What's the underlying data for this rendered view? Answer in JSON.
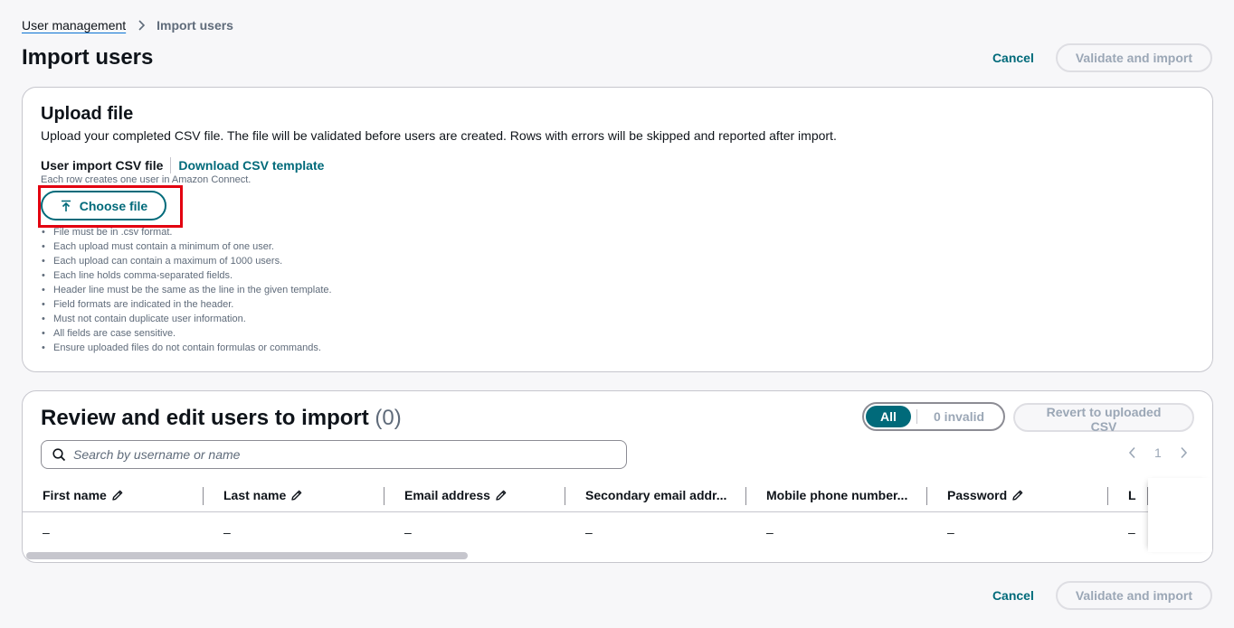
{
  "breadcrumb": {
    "parent": "User management",
    "current": "Import users"
  },
  "page_title": "Import users",
  "actions": {
    "cancel": "Cancel",
    "validate": "Validate and import"
  },
  "upload": {
    "title": "Upload file",
    "description": "Upload your completed CSV file. The file will be validated before users are created. Rows with errors will be skipped and reported after import.",
    "field_label": "User import CSV file",
    "template_link": "Download CSV template",
    "hint": "Each row creates one user in Amazon Connect.",
    "choose_file": "Choose file",
    "rules": [
      "File must be in .csv format.",
      "Each upload must contain a minimum of one user.",
      "Each upload can contain a maximum of 1000 users.",
      "Each line holds comma-separated fields.",
      "Header line must be the same as the line in the given template.",
      "Field formats are indicated in the header.",
      "Must not contain duplicate user information.",
      "All fields are case sensitive.",
      "Ensure uploaded files do not contain formulas or commands."
    ]
  },
  "review": {
    "title": "Review and edit users to import",
    "count": "(0)",
    "filter_all": "All",
    "filter_invalid": "0 invalid",
    "revert": "Revert to uploaded CSV",
    "search_placeholder": "Search by username or name",
    "page": "1",
    "columns": [
      "First name",
      "Last name",
      "Email address",
      "Secondary email addr...",
      "Mobile phone number...",
      "Password"
    ],
    "partial_column": "L",
    "row": [
      "–",
      "–",
      "–",
      "–",
      "–",
      "–"
    ],
    "partial_cell": "–"
  },
  "colors": {
    "accent": "#006a7a",
    "highlight": "#e3000f",
    "link": "#006ce0"
  }
}
